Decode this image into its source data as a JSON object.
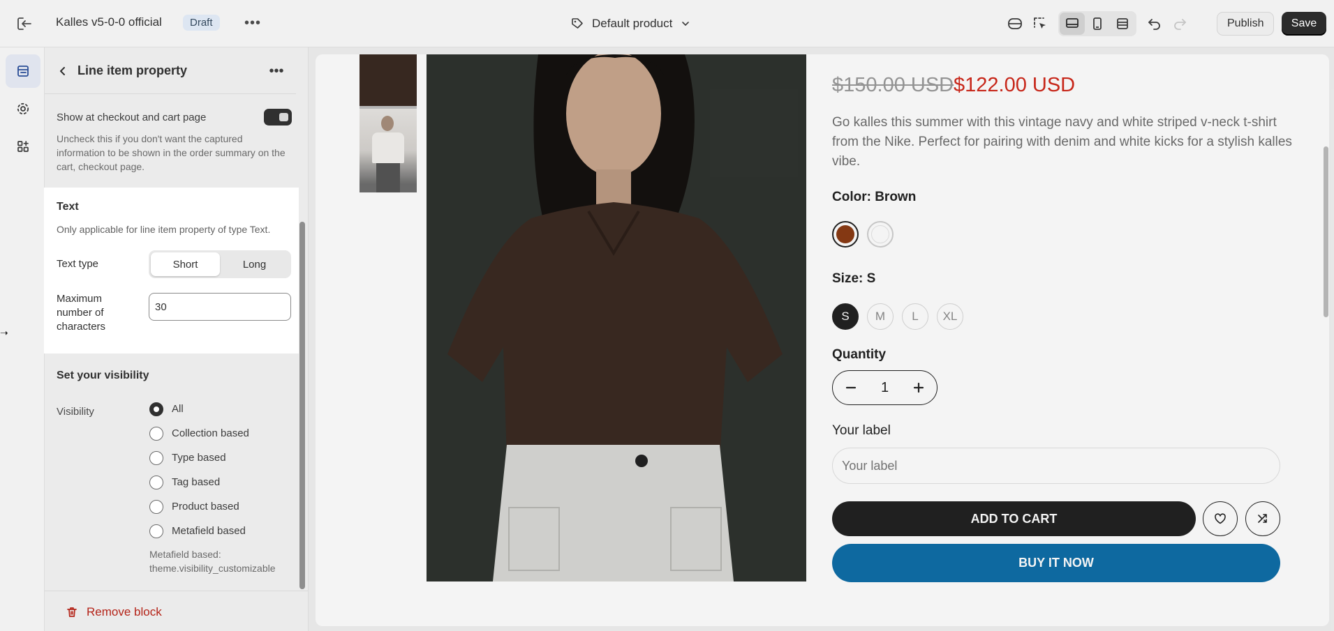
{
  "topbar": {
    "store_name": "Kalles v5-0-0 official",
    "status_badge": "Draft",
    "template_name": "Default product",
    "publish_label": "Publish",
    "save_label": "Save"
  },
  "panel": {
    "title": "Line item property",
    "checkout_label": "Show at checkout and cart page",
    "checkout_enabled": true,
    "checkout_help": "Uncheck this if you don't want the captured information to be shown in the order summary on the cart, checkout page.",
    "text_section": {
      "title": "Text",
      "help": "Only applicable for line item property of type Text.",
      "type_label": "Text type",
      "type_options": [
        "Short",
        "Long"
      ],
      "type_selected": "Short",
      "max_label": "Maximum number of characters",
      "max_value": "30"
    },
    "visibility": {
      "title": "Set your visibility",
      "label": "Visibility",
      "options": [
        "All",
        "Collection based",
        "Type based",
        "Tag based",
        "Product based",
        "Metafield based"
      ],
      "selected": "All",
      "note": "Metafield based: theme.visibility_customizable"
    },
    "remove_label": "Remove block"
  },
  "product": {
    "price_old": "$150.00 USD",
    "price_new": "$122.00 USD",
    "description": "Go kalles this summer with this vintage navy and white striped v-neck t-shirt from the Nike. Perfect for pairing with denim and white kicks for a stylish kalles vibe.",
    "color_label": "Color: Brown",
    "swatch_colors": [
      "#8a3b14",
      "#ffffff"
    ],
    "size_label": "Size: S",
    "sizes": [
      "S",
      "M",
      "L",
      "XL"
    ],
    "selected_size": "S",
    "quantity_label": "Quantity",
    "quantity": "1",
    "your_label_title": "Your label",
    "your_label_placeholder": "Your label",
    "add_to_cart": "ADD TO CART",
    "buy_now": "BUY IT NOW"
  },
  "colors": {
    "accent_blue": "#0f6ea8",
    "sale_red": "#d0281b",
    "danger": "#b42318"
  }
}
